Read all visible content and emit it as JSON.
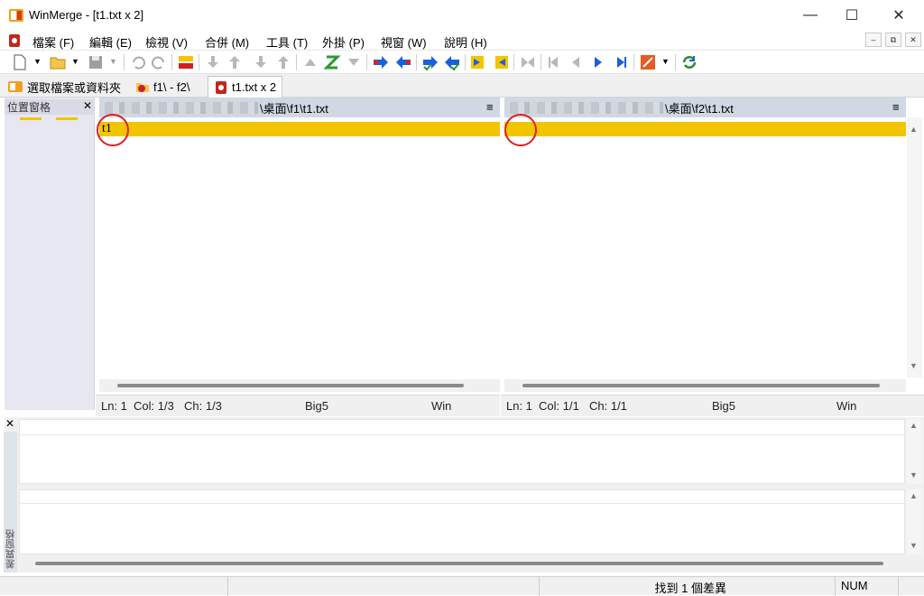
{
  "window": {
    "title": "WinMerge - [t1.txt x 2]",
    "minimize": "—",
    "maximize": "☐",
    "close": "✕"
  },
  "menu": [
    "檔案 (F)",
    "編輯 (E)",
    "檢視 (V)",
    "合併 (M)",
    "工具 (T)",
    "外掛 (P)",
    "視窗 (W)",
    "說明 (H)"
  ],
  "mdi": {
    "min": "–",
    "restore": "⧉",
    "close": "✕"
  },
  "tabs": [
    {
      "label": "選取檔案或資料夾"
    },
    {
      "label": "f1\\ - f2\\"
    },
    {
      "label": "t1.txt x 2"
    }
  ],
  "location_pane": {
    "title": "位置窗格",
    "close": "✕"
  },
  "left": {
    "path": "\\桌面\\f1\\t1.txt",
    "menu": "≡",
    "line1": "t1",
    "status": {
      "ln": "Ln: 1",
      "col": "Col: 1/3",
      "ch": "Ch: 1/3",
      "enc": "Big5",
      "eol": "Win"
    }
  },
  "right": {
    "path": "\\桌面\\f2\\t1.txt",
    "menu": "≡",
    "line1": "",
    "status": {
      "ln": "Ln: 1",
      "col": "Col: 1/1",
      "ch": "Ch: 1/1",
      "enc": "Big5",
      "eol": "Win"
    }
  },
  "diff_pane": {
    "title": "差異窗格",
    "close": "✕"
  },
  "statusbar": {
    "diffs": "找到 1 個差異",
    "num": "NUM"
  },
  "colors": {
    "diff": "#f2c500",
    "header": "#cfd8e3",
    "annotation": "#e02020"
  }
}
